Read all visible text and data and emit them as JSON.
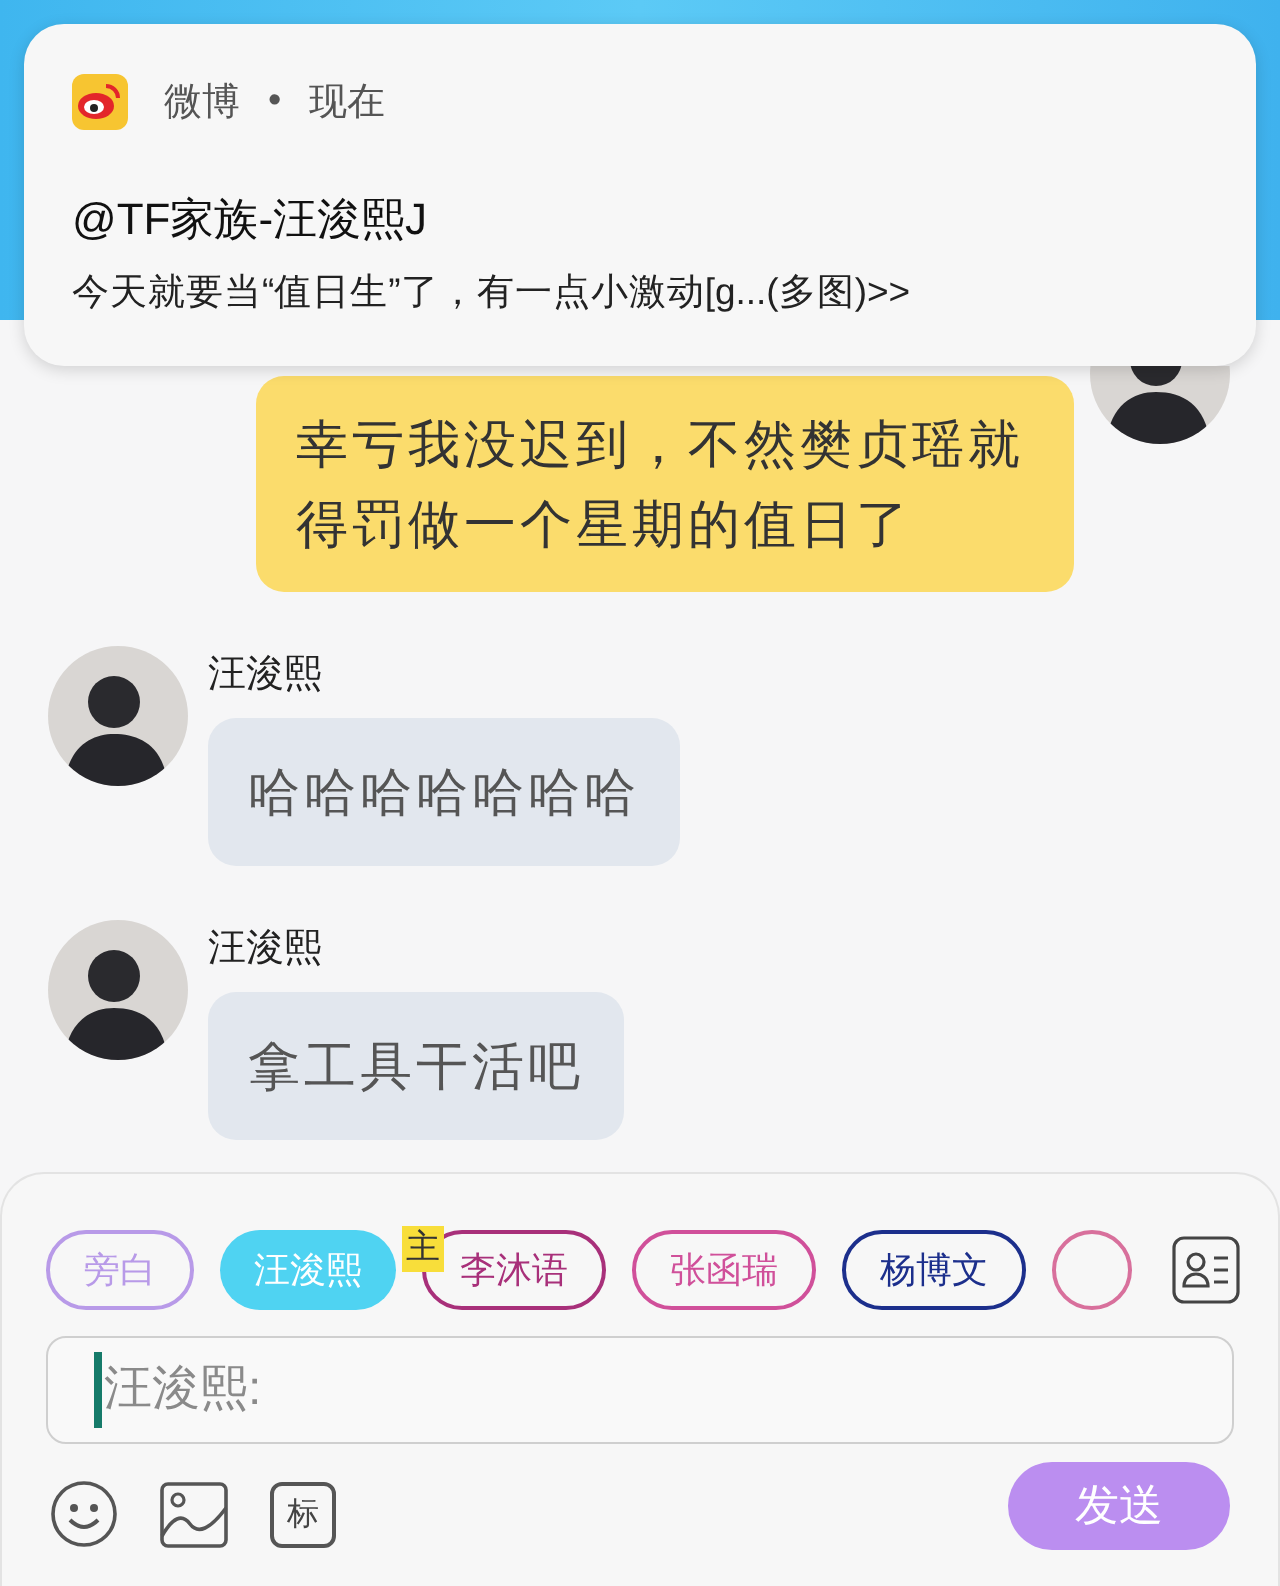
{
  "notification": {
    "app": "微博",
    "separator": "•",
    "time": "现在",
    "title": "@TF家族-汪浚熙J",
    "body": "今天就要当“值日生”了，有一点小激动[g...(多图)>>"
  },
  "messages": [
    {
      "kind": "outgoing",
      "text": "幸亏我没迟到，不然樊贞瑶就得罚做一个星期的值日了"
    },
    {
      "kind": "incoming",
      "sender": "汪浚熙",
      "text": "哈哈哈哈哈哈哈"
    },
    {
      "kind": "incoming",
      "sender": "汪浚熙",
      "text": "拿工具干活吧"
    }
  ],
  "composer": {
    "roles": [
      {
        "label": "旁白",
        "color": "#b89ae8",
        "selected": false
      },
      {
        "label": "汪浚熙",
        "color": "#4fd3f2",
        "selected": true
      },
      {
        "label": "李沐语",
        "color": "#a8307a",
        "selected": false,
        "badge": "主"
      },
      {
        "label": "张函瑞",
        "color": "#d0509a",
        "selected": false
      },
      {
        "label": "杨博文",
        "color": "#1c2f8c",
        "selected": false
      },
      {
        "color": "#d8709c",
        "selected": false
      }
    ],
    "input": {
      "placeholder": "汪浚熙:"
    },
    "tag_button": "标",
    "send_button": "发送"
  }
}
